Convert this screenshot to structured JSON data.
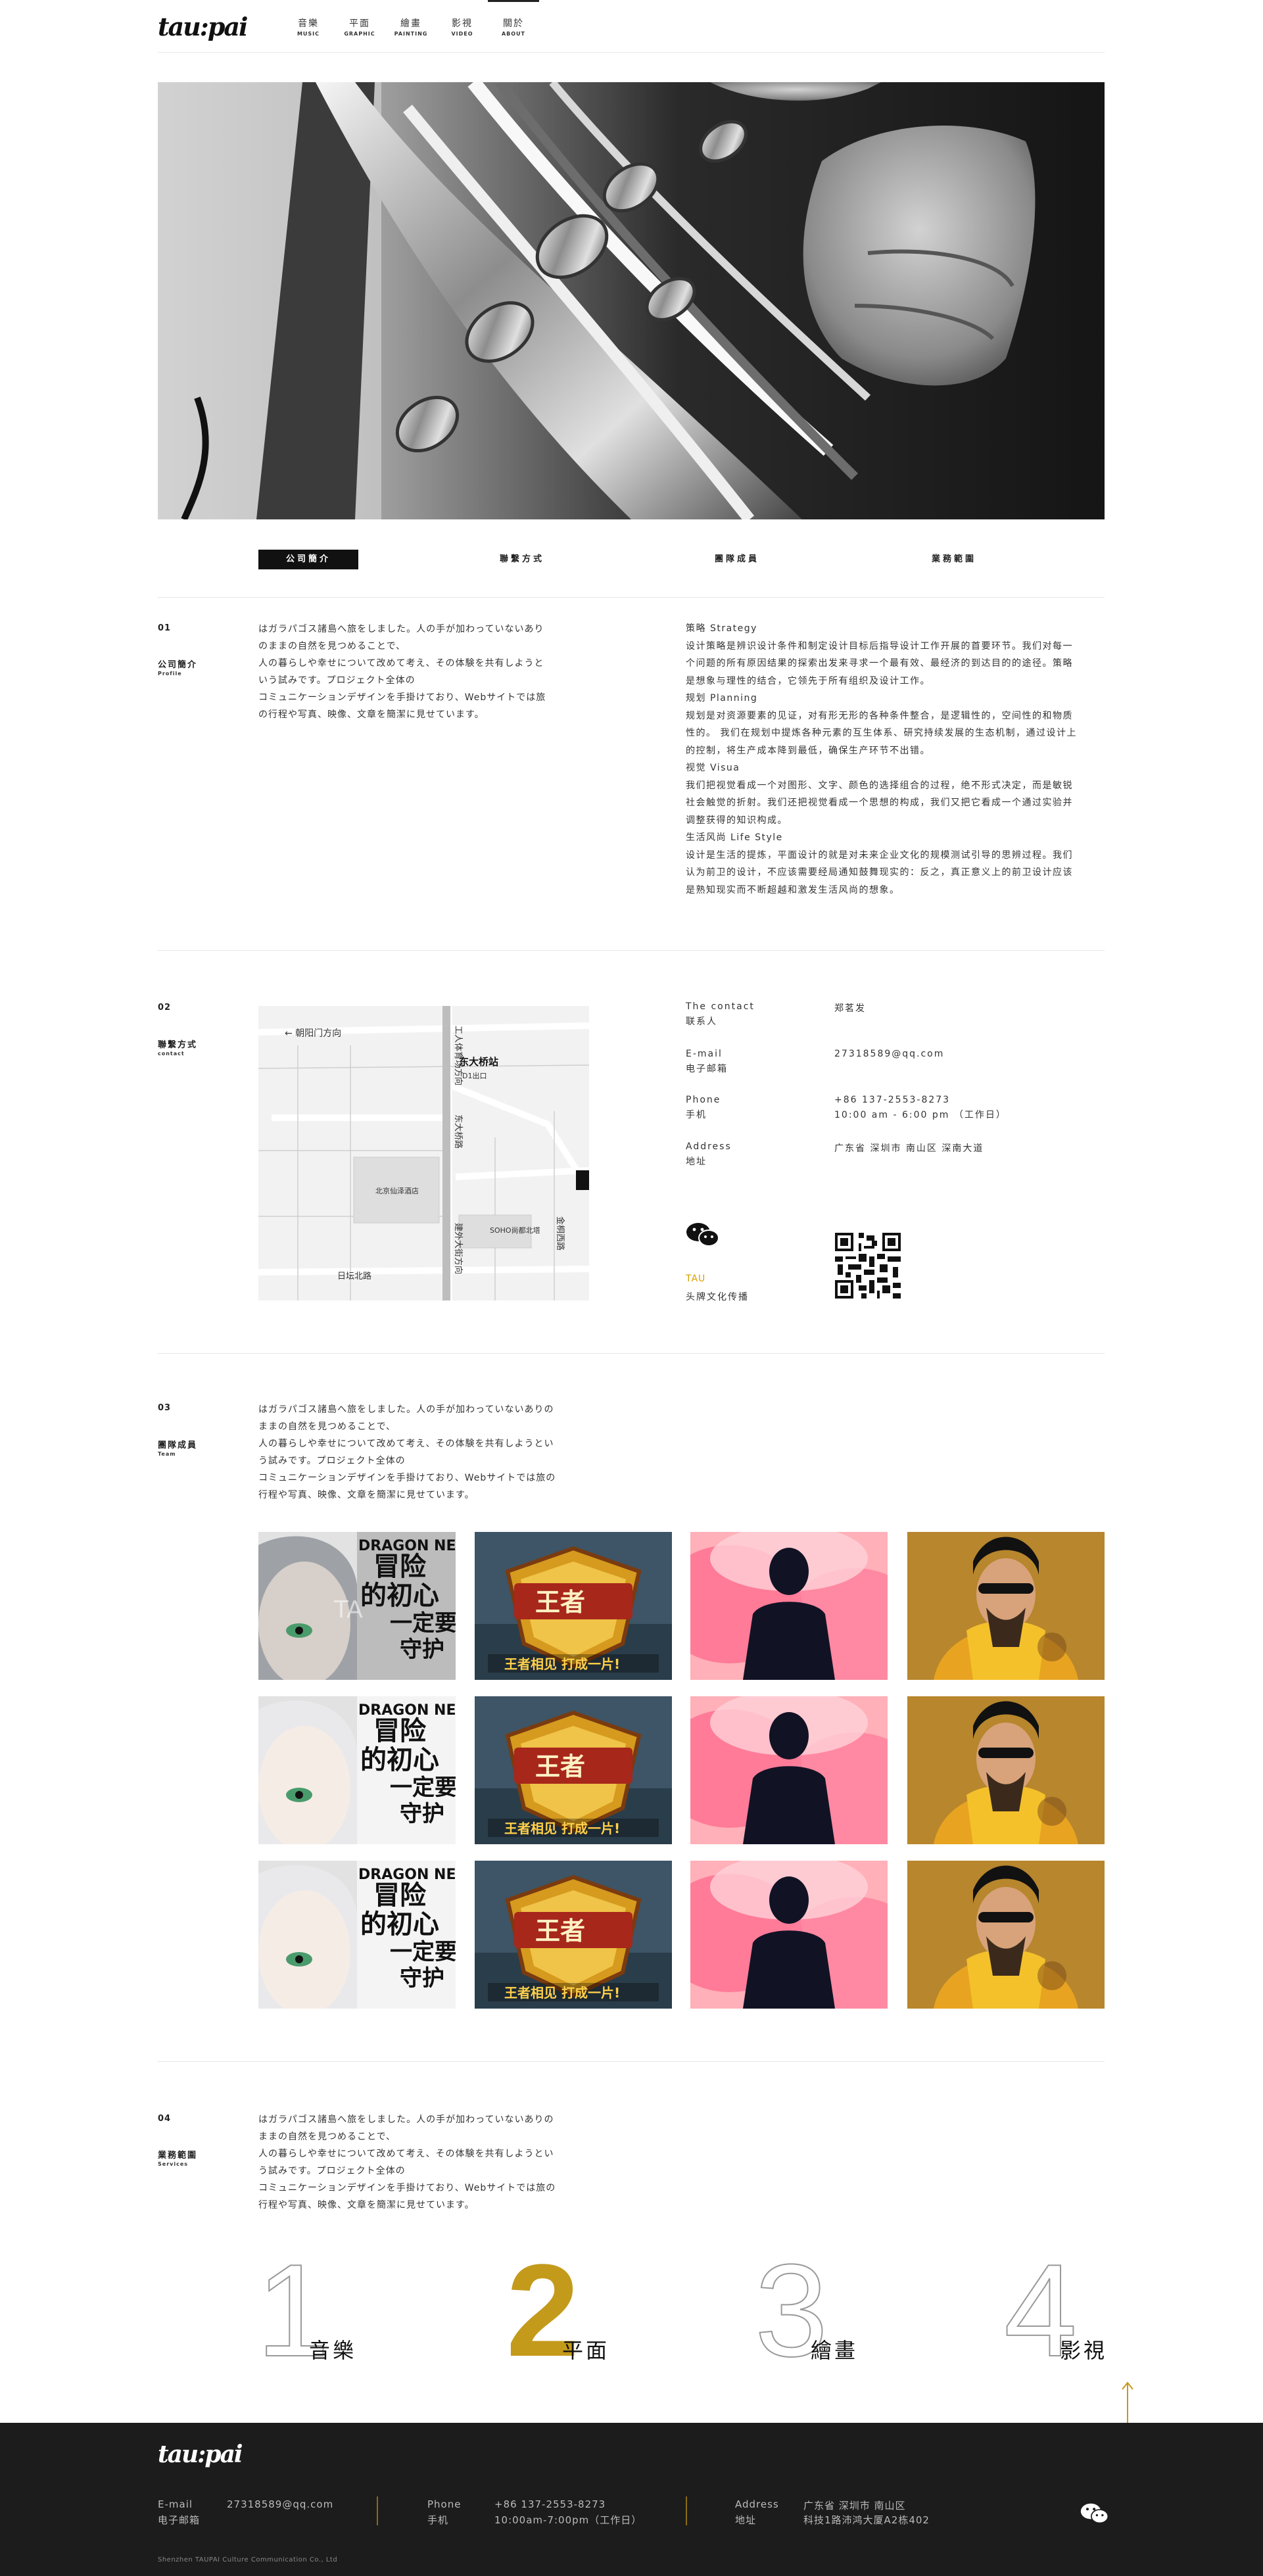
{
  "brand": {
    "logo": "tau:pai"
  },
  "nav": [
    {
      "cn": "音樂",
      "en": "MUSIC"
    },
    {
      "cn": "平面",
      "en": "GRAPHIC"
    },
    {
      "cn": "繪畫",
      "en": "PAINTING"
    },
    {
      "cn": "影視",
      "en": "VIDEO"
    },
    {
      "cn": "關於",
      "en": "ABOUT"
    }
  ],
  "tabs": [
    "公司簡介",
    "聯繫方式",
    "團隊成員",
    "業務範圍"
  ],
  "sections": {
    "profile": {
      "num": "01",
      "title": "公司簡介",
      "sub": "Profile",
      "lines": [
        "はガラパゴス諸島へ旅をしました。人の手が加わっていないあり",
        "のままの自然を見つめることで、",
        "人の暮らしや幸せについて改めて考え、その体験を共有しようと",
        "いう試みです。プロジェクト全体の",
        "コミュニケーションデザインを手掛けており、Webサイトでは旅",
        "の行程や写真、映像、文章を簡潔に見せています。"
      ]
    },
    "strategy_lines": [
      {
        "t": "策略 Strategy",
        "h": true
      },
      {
        "t": "设计策略是辨识设计条件和制定设计目标后指导设计工作开展的首要环节。我们对每一"
      },
      {
        "t": "个问题的所有原因结果的探索出发来寻求一个最有效、最经济的到达目的的途径。策略"
      },
      {
        "t": "是想象与理性的结合，它领先于所有组织及设计工作。"
      },
      {
        "t": "规划 Planning",
        "h": true
      },
      {
        "t": "规划是对资源要素的见证，对有形无形的各种条件整合，是逻辑性的，空间性的和物质"
      },
      {
        "t": "性的。 我们在规划中提炼各种元素的互生体系、研究持续发展的生态机制，通过设计上"
      },
      {
        "t": "的控制，将生产成本降到最低，确保生产环节不出错。"
      },
      {
        "t": "视觉 Visua",
        "h": true
      },
      {
        "t": "我们把视觉看成一个对图形、文字、颜色的选择组合的过程，绝不形式决定，而是敏锐"
      },
      {
        "t": "社会触觉的折射。我们还把视觉看成一个思想的构成，我们又把它看成一个通过实验并"
      },
      {
        "t": "调整获得的知识构成。"
      },
      {
        "t": "生活风尚 Life Style",
        "h": true
      },
      {
        "t": "设计是生活的提炼，平面设计的就是对未来企业文化的规模测试引导的思辨过程。我们"
      },
      {
        "t": "认为前卫的设计，不应该需要经局通知鼓舞现实的：反之，真正意义上的前卫设计应该"
      },
      {
        "t": "是熟知现实而不断超越和激发生活风尚的想象。"
      }
    ],
    "contact": {
      "num": "02",
      "title": "聯繫方式",
      "sub": "contact",
      "rows": [
        {
          "k1": "The contact",
          "k2": "联系人",
          "v1": "郑茗发",
          "v2": ""
        },
        {
          "k1": "E-mail",
          "k2": "电子邮箱",
          "v1": "27318589@qq.com",
          "v2": ""
        },
        {
          "k1": "Phone",
          "k2": "手机",
          "v1": "+86 137-2553-8273",
          "v2": "10:00 am - 6:00 pm  （工作日）"
        },
        {
          "k1": "Address",
          "k2": "地址",
          "v1": "广东省 深圳市 南山区 深南大道",
          "v2": ""
        }
      ],
      "tau": "TAU",
      "company": "头牌文化传播"
    },
    "map": {
      "north": "← 朝阳门方向",
      "road1": "工人体育场方向",
      "road2": "东大桥路",
      "road3": "建外大街方向",
      "road4": "日坛北路",
      "road5": "金桐西路",
      "station": "东大桥站",
      "exit": "D1出口",
      "poi1": "北京仙泽酒店",
      "poi2": "SOHO尚都北塔"
    },
    "team": {
      "num": "03",
      "title": "團隊成員",
      "sub": "Team",
      "lines": [
        "はガラパゴス諸島へ旅をしました。人の手が加わっていないありの",
        "ままの自然を見つめることで、",
        "人の暮らしや幸せについて改めて考え、その体験を共有しようとい",
        "う試みです。プロジェクト全体の",
        "コミュニケーションデザインを手掛けており、Webサイトでは旅の",
        "行程や写真、映像、文章を簡潔に見せています。"
      ],
      "dn_title": "DRAGON NEST",
      "dn_line1": "冒险",
      "dn_line2": "的初心",
      "dn_line3": "一定要",
      "dn_line4": "守护",
      "jk_slogan": "王者相见 打成一片!",
      "watermark": "TA"
    },
    "services": {
      "num": "04",
      "title": "業務範圍",
      "sub": "Services",
      "lines": [
        "はガラパゴス諸島へ旅をしました。人の手が加わっていないありの",
        "ままの自然を見つめることで、",
        "人の暮らしや幸せについて改めて考え、その体験を共有しようとい",
        "う試みです。プロジェクト全体の",
        "コミュニケーションデザインを手掛けており、Webサイトでは旅の",
        "行程や写真、映像、文章を簡潔に見せています。"
      ],
      "items": [
        {
          "n": "1",
          "label": "音樂"
        },
        {
          "n": "2",
          "label": "平面"
        },
        {
          "n": "3",
          "label": "繪畫"
        },
        {
          "n": "4",
          "label": "影視"
        }
      ]
    }
  },
  "footer": {
    "logo": "tau:pai",
    "email_k1": "E-mail",
    "email_k2": "电子邮箱",
    "email_v": "27318589@qq.com",
    "phone_k1": "Phone",
    "phone_k2": "手机",
    "phone_v1": "+86 137-2553-8273",
    "phone_v2": "10:00am-7:00pm（工作日）",
    "addr_k1": "Address",
    "addr_k2": "地址",
    "addr_v1": "广东省 深圳市 南山区",
    "addr_v2": "科技1路沛鸿大厦A2栋402",
    "copyright": "Shenzhen TAUPAI Culture Communication Co., Ltd"
  },
  "colors": {
    "accent": "#c49a1b",
    "footer_bg": "#1c1c1c",
    "tab_active": "#111111"
  }
}
